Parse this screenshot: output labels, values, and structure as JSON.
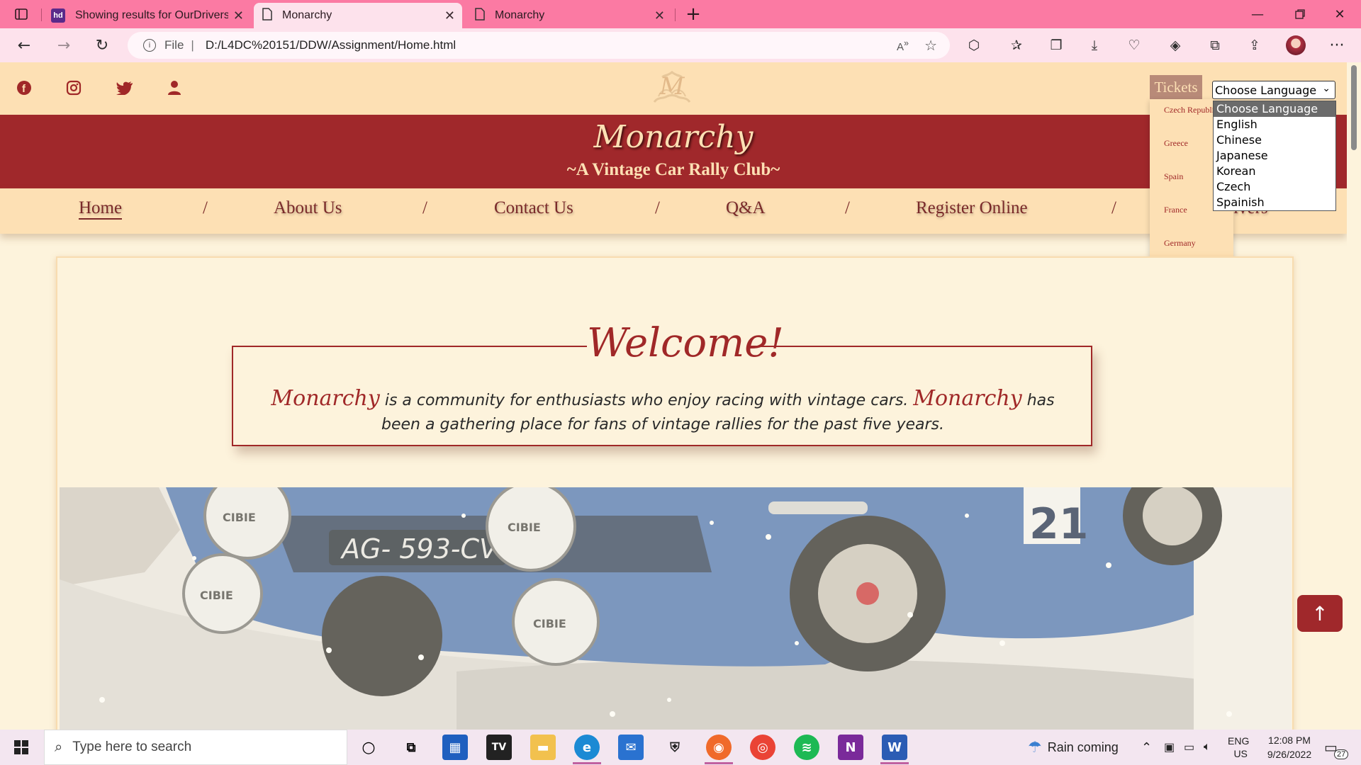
{
  "browser": {
    "tabs": [
      {
        "title": "Showing results for OurDrivers.h",
        "icon": "site-logo-icon"
      },
      {
        "title": "Monarchy",
        "icon": "page-icon"
      },
      {
        "title": "Monarchy",
        "icon": "page-icon"
      }
    ],
    "address": {
      "scheme_label": "File",
      "url": "D:/L4DC%20151/DDW/Assignment/Home.html"
    },
    "window_controls": [
      "minimize",
      "restore",
      "close"
    ]
  },
  "site": {
    "logo_letter": "M",
    "brand": "Monarchy",
    "tagline": "~A Vintage Car Rally Club~",
    "social_icons": [
      "facebook-icon",
      "instagram-icon",
      "twitter-icon",
      "user-icon"
    ],
    "nav": [
      {
        "label": "Home",
        "active": true
      },
      {
        "label": "About Us"
      },
      {
        "label": "Contact Us"
      },
      {
        "label": "Q&A"
      },
      {
        "label": "Register Online"
      },
      {
        "label": "ivers"
      }
    ],
    "nav_separator": "/",
    "tickets": {
      "label": "Tickets",
      "items": [
        "Czech Republic",
        "Greece",
        "Spain",
        "France",
        "Germany"
      ]
    },
    "language": {
      "selected": "Choose Language",
      "options": [
        "Choose Language",
        "English",
        "Chinese",
        "Japanese",
        "Korean",
        "Czech",
        "Spainish"
      ]
    },
    "welcome": {
      "title": "Welcome!",
      "brand_inline": "Monarchy",
      "text_part1": "is a community for enthusiasts who enjoy racing with vintage cars.",
      "text_part2": "has been a gathering place for fans of vintage rallies for the past five years."
    },
    "photo": {
      "plate": "AG- 593-CV",
      "lamp_brand": "CIBIE",
      "number": "21"
    },
    "back_to_top_icon": "arrow-up-icon"
  },
  "taskbar": {
    "search_placeholder": "Type here to search",
    "weather": "Rain coming",
    "lang_top": "ENG",
    "lang_bottom": "US",
    "time": "12:08 PM",
    "date": "9/26/2022",
    "notification_count": "27"
  }
}
